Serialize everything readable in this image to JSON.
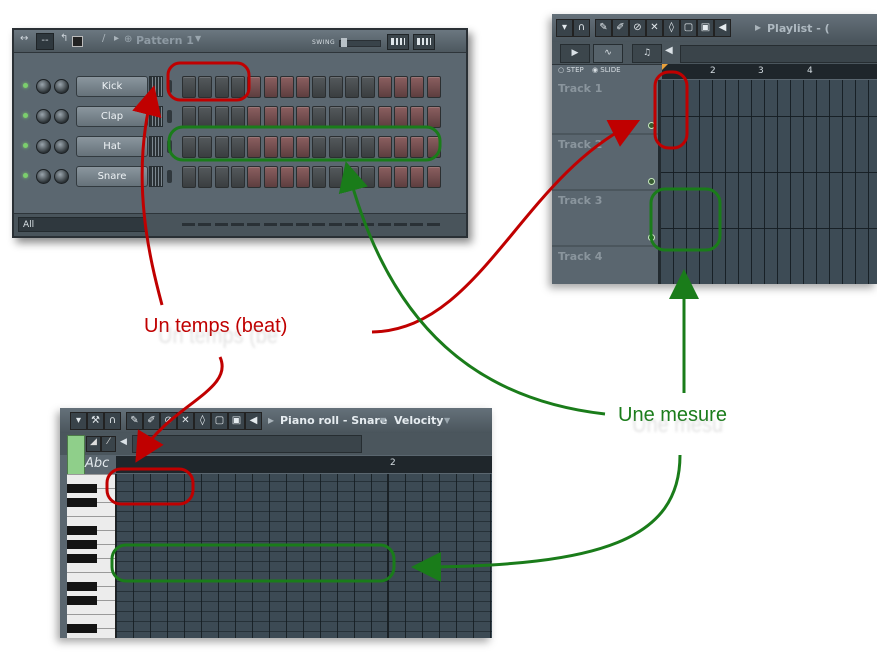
{
  "channel_rack": {
    "pattern_name": "Pattern 1",
    "swing_label": "SWING",
    "filter_label": "All",
    "channels": [
      {
        "name": "Kick"
      },
      {
        "name": "Clap"
      },
      {
        "name": "Hat"
      },
      {
        "name": "Snare"
      }
    ],
    "steps_per_channel": 16,
    "step_colors": {
      "dark": "#4a4e50",
      "red": "#76504f"
    }
  },
  "playlist": {
    "title": "Playlist - (",
    "step_label": "STEP",
    "slide_label": "SLIDE",
    "ruler_numbers": [
      "2",
      "3",
      "4"
    ],
    "tracks": [
      "Track 1",
      "Track 2",
      "Track 3",
      "Track 4"
    ]
  },
  "piano_roll": {
    "title": "Piano roll - Snare",
    "velocity_label": "Velocity",
    "abc_label": "Abc",
    "ruler_numbers": [
      "2"
    ]
  },
  "annotations": {
    "beat_label": "Un temps (beat)",
    "beat_ghost": "Un temps (be",
    "measure_label": "Une mesure",
    "measure_ghost": "Une mesu",
    "beat_color": "#c00000",
    "measure_color": "#1a7c1a"
  }
}
